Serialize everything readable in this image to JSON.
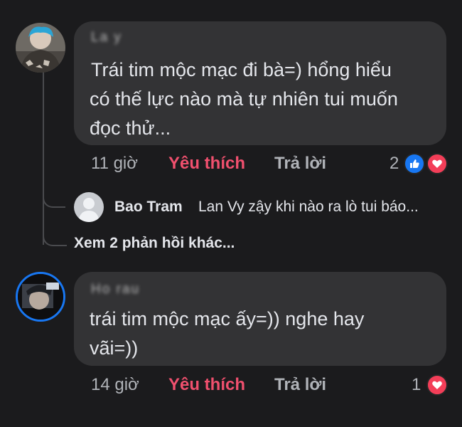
{
  "comments": [
    {
      "author": "La  y",
      "text": [
        "Trái tim mộc mạc đi bà=) hổng hiểu",
        "có thế lực nào mà tự nhiên tui muốn",
        "đọc thử..."
      ],
      "time": "11 giờ",
      "like_label": "Yêu thích",
      "reply_label": "Trả lời",
      "reaction_count": "2",
      "reactions": [
        "like-icon",
        "love-icon"
      ]
    },
    {
      "author": "Ho        rau",
      "text": [
        "trái tim mộc mạc ấy=)) nghe hay",
        "vãi=))"
      ],
      "time": "14 giờ",
      "like_label": "Yêu thích",
      "reply_label": "Trả lời",
      "reaction_count": "1",
      "reactions": [
        "love-icon"
      ]
    }
  ],
  "reply_preview": {
    "name": "Bao Tram",
    "text": "Lan Vy zậy khi nào ra lò tui báo..."
  },
  "view_more": "Xem 2 phản hồi khác...",
  "colors": {
    "background": "#1b1b1d",
    "bubble": "#333335",
    "like_active": "#f0506e",
    "like_badge": "#1877f2",
    "love_badge": "#f33e58",
    "secondary_text": "#b0b3b8"
  }
}
